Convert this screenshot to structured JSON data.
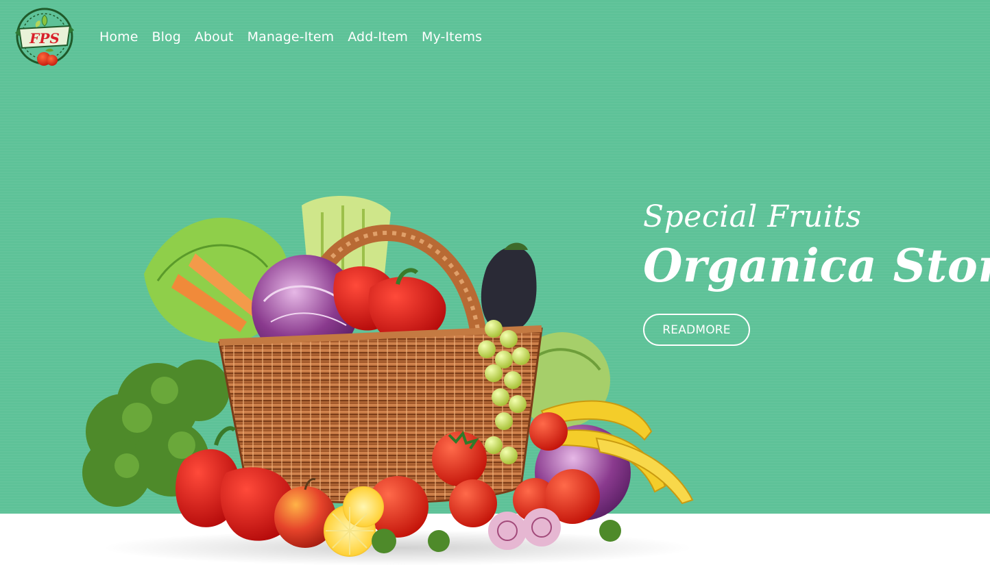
{
  "brand": {
    "logo_text": "FPS"
  },
  "nav": {
    "items": [
      {
        "label": "Home"
      },
      {
        "label": "Blog"
      },
      {
        "label": "About"
      },
      {
        "label": "Manage-Item"
      },
      {
        "label": "Add-Item"
      },
      {
        "label": "My-Items"
      }
    ]
  },
  "hero": {
    "subtitle": "Special Fruits",
    "title": "Organica Store",
    "cta_label": "READMORE",
    "image": "fruit-vegetable-basket-illustration"
  },
  "colors": {
    "hero_background": "#5ec298",
    "text": "#ffffff",
    "floor": "#ffffff"
  }
}
